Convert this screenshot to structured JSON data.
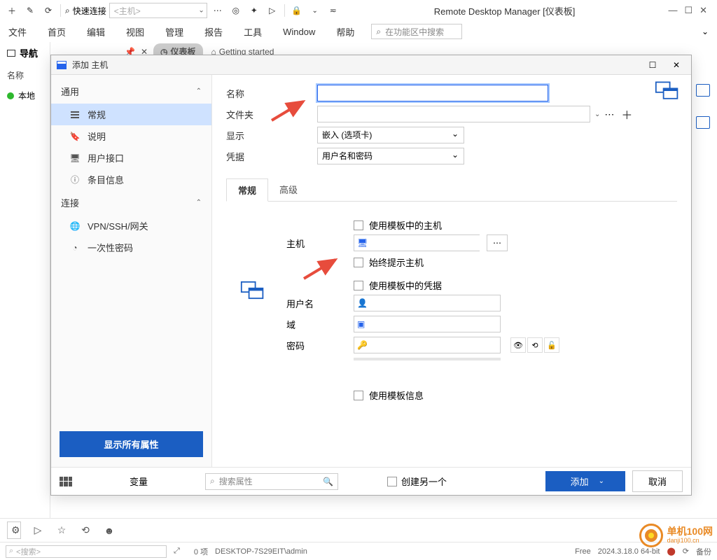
{
  "app_title": "Remote Desktop Manager [仪表板]",
  "quickconnect": {
    "label": "快速连接",
    "placeholder": "<主机>"
  },
  "menu": [
    "文件",
    "首页",
    "编辑",
    "视图",
    "管理",
    "报告",
    "工具",
    "Window",
    "帮助"
  ],
  "ribbon_search": "在功能区中搜索",
  "nav": {
    "title": "导航",
    "column": "名称",
    "item": "本地"
  },
  "doc_tabs": {
    "dashboard": "仪表板",
    "getting_started": "Getting started"
  },
  "dialog": {
    "title": "添加 主机",
    "sidebar": {
      "section_general": "通用",
      "items_general": [
        "常规",
        "说明",
        "用户接口",
        "条目信息"
      ],
      "section_connect": "连接",
      "items_connect": [
        "VPN/SSH/网关",
        "一次性密码"
      ],
      "show_all": "显示所有属性"
    },
    "form": {
      "name": "名称",
      "folder": "文件夹",
      "display": "显示",
      "display_value": "嵌入 (选项卡)",
      "credentials": "凭据",
      "credentials_value": "用户名和密码"
    },
    "tabs": {
      "general": "常规",
      "advanced": "高级"
    },
    "sub": {
      "use_template_host": "使用模板中的主机",
      "host": "主机",
      "always_prompt_host": "始终提示主机",
      "use_template_creds": "使用模板中的凭据",
      "username": "用户名",
      "domain": "域",
      "password": "密码",
      "use_template_info": "使用模板信息"
    },
    "bottom": {
      "variables": "变量",
      "search_props": "搜索属性",
      "create_another": "创建另一个",
      "add": "添加",
      "cancel": "取消"
    }
  },
  "status": {
    "items": "0 项",
    "host_user": "DESKTOP-7S29EIT\\admin",
    "license": "Free",
    "version": "2024.3.18.0 64-bit",
    "backup": "备份",
    "search_placeholder": "<搜索>"
  },
  "watermark": {
    "name": "单机100网",
    "url": "danji100.cn"
  }
}
